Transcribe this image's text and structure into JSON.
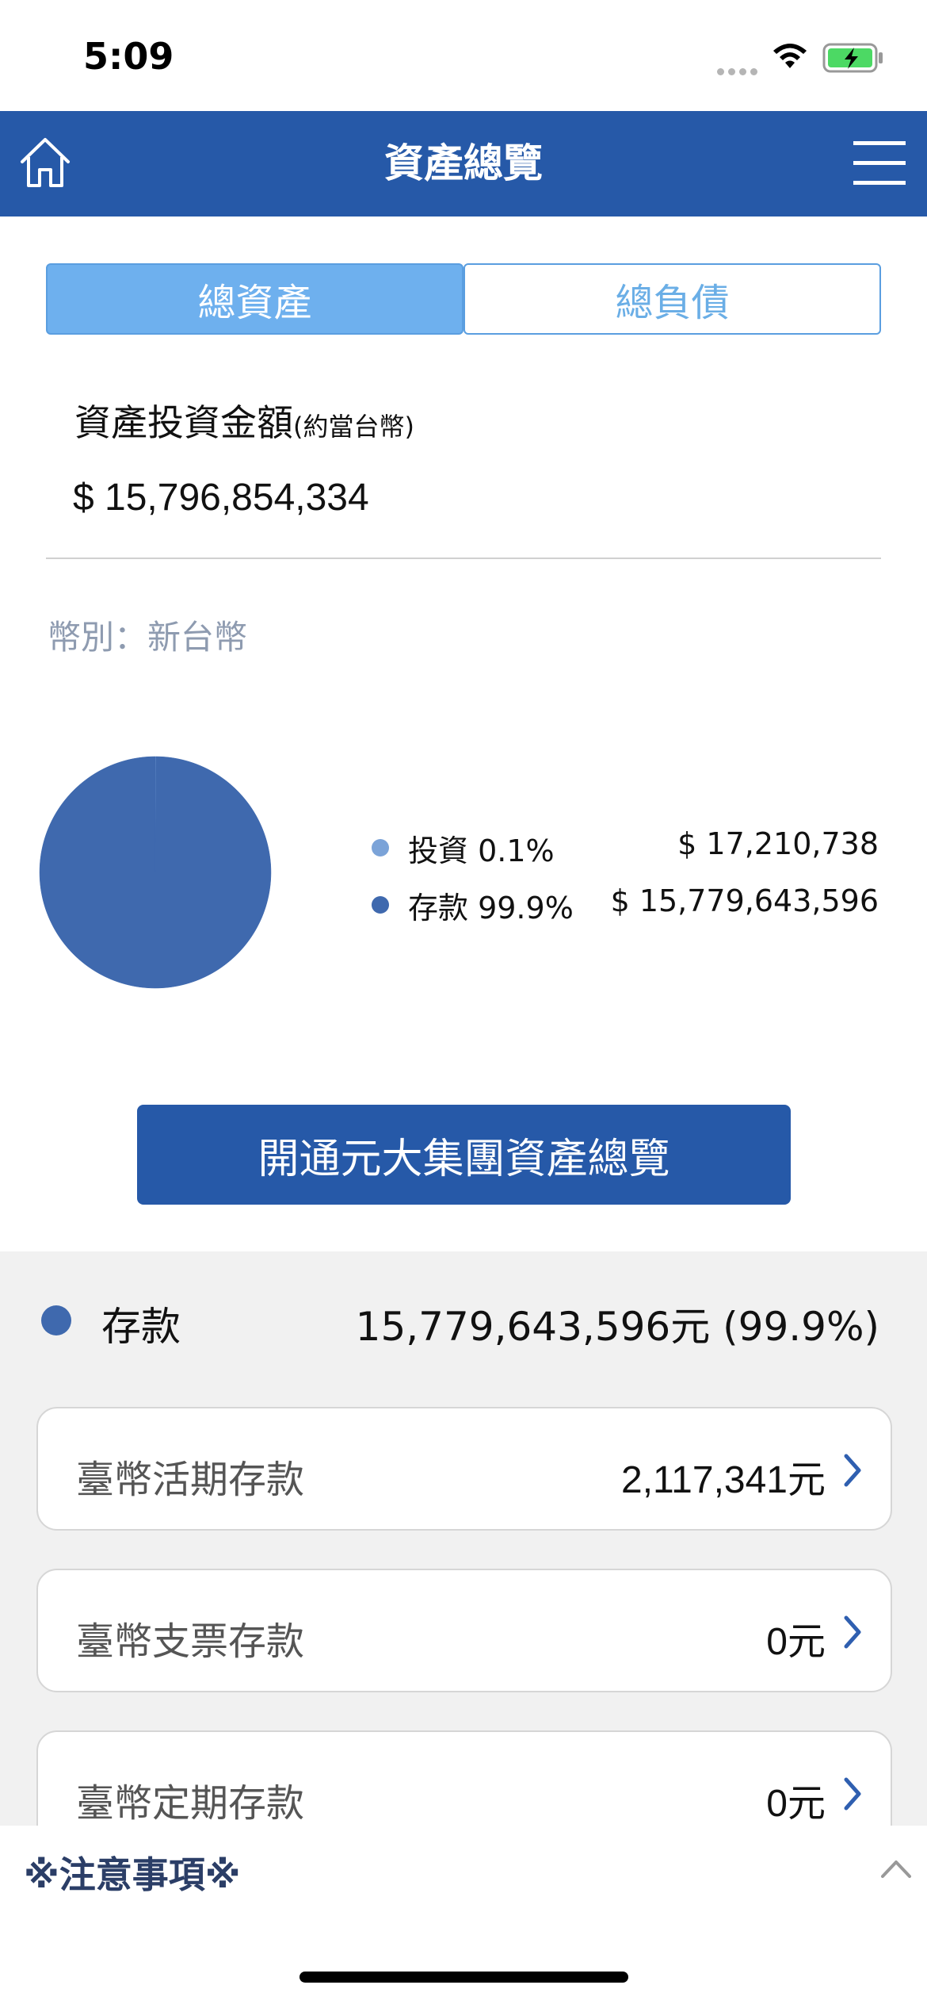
{
  "status_bar": {
    "time": "5:09"
  },
  "nav": {
    "title": "資產總覽"
  },
  "tabs": [
    {
      "label": "總資產",
      "active": true
    },
    {
      "label": "總負債",
      "active": false
    }
  ],
  "summary": {
    "label": "資產投資金額",
    "label_note": "(約當台幣)",
    "amount": "$ 15,796,854,334",
    "currency": "幣別：新台幣"
  },
  "chart_data": {
    "type": "pie",
    "slices": [
      {
        "name": "投資",
        "percent": 0.1,
        "value": 17210738,
        "color": "#7ba3d8"
      },
      {
        "name": "存款",
        "percent": 99.9,
        "value": 15779643596,
        "color": "#3f69ae"
      }
    ]
  },
  "legend": [
    {
      "name": "投資 0.1%",
      "value": "$ 17,210,738",
      "color": "#7ba3d8"
    },
    {
      "name": "存款 99.9%",
      "value": "$ 15,779,643,596",
      "color": "#3f69ae"
    }
  ],
  "cta": {
    "label": "開通元大集團資產總覽"
  },
  "deposits": {
    "label": "存款",
    "total": "15,779,643,596元 (99.9%)",
    "color": "#3f69ae",
    "accounts": [
      {
        "name": "臺幣活期存款",
        "value": "2,117,341元"
      },
      {
        "name": "臺幣支票存款",
        "value": "0元"
      },
      {
        "name": "臺幣定期存款",
        "value": "0元"
      }
    ]
  },
  "notes": {
    "title": "※注意事項※"
  },
  "colors": {
    "brand": "#2659a8",
    "tab_active": "#6eb0ee",
    "chevron": "#2f5fb0"
  }
}
